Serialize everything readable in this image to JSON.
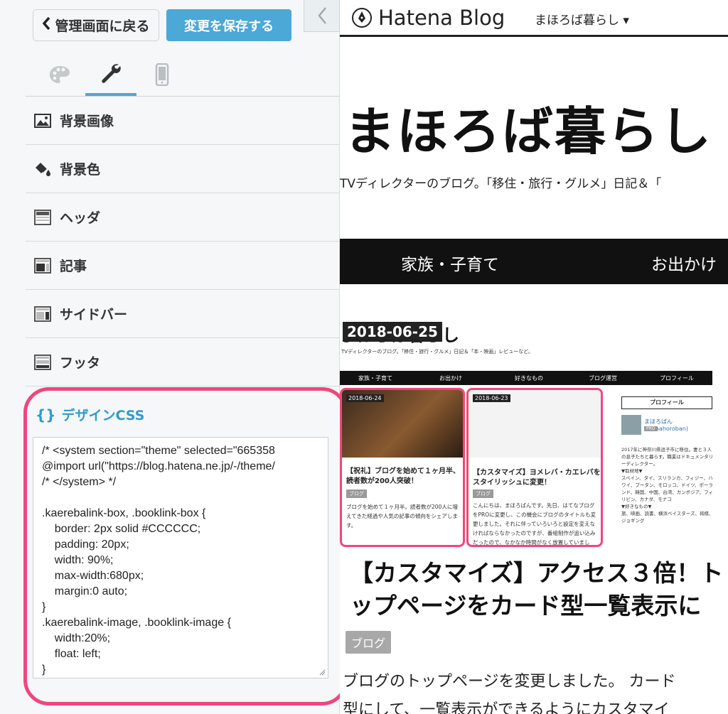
{
  "toolbar": {
    "back_label": "管理画面に戻る",
    "save_label": "変更を保存する"
  },
  "sidebar": {
    "items": [
      {
        "label": "背景画像",
        "icon": "image-icon"
      },
      {
        "label": "背景色",
        "icon": "paint-bucket-icon"
      },
      {
        "label": "ヘッダ",
        "icon": "layout-header-icon"
      },
      {
        "label": "記事",
        "icon": "layout-article-icon"
      },
      {
        "label": "サイドバー",
        "icon": "layout-sidebar-icon"
      },
      {
        "label": "フッタ",
        "icon": "layout-footer-icon"
      }
    ]
  },
  "css_panel": {
    "icon_text": "{}",
    "title": "デザインCSS",
    "code": "/* <system section=\"theme\" selected=\"665358\n@import url(\"https://blog.hatena.ne.jp/-/theme/\n/* </system> */\n\n.kaerebalink-box, .booklink-box {\n    border: 2px solid #CCCCCC;\n    padding: 20px;\n    width: 90%;\n    max-width:680px;\n    margin:0 auto;\n}\n.kaerebalink-image, .booklink-image {\n    width:20%;\n    float: left;\n}"
  },
  "preview": {
    "brand": "Hatena Blog",
    "blog_selector": "まほろば暮らし ▾",
    "blog_title": "まほろば暮らし",
    "blog_desc": "TVディレクターのブログ。「移住・旅行・グルメ」日記＆「",
    "nav": [
      "家族・子育て",
      "お出かけ"
    ],
    "date": "2018-06-25",
    "date_bg": "まほろば暮らし",
    "mini": {
      "desc": "TVディレクターのブログ。「移住・旅行・グルメ」日記＆「本・映画」レビューなど。",
      "nav": [
        "家族・子育て",
        "お出かけ",
        "好きなもの",
        "ブログ運営",
        "プロフィール"
      ],
      "cards": [
        {
          "date": "2018-06-24",
          "title": "【祝礼】ブログを始めて１ヶ月半、読者数が200人突破！",
          "tag": "ブログ",
          "text": "ブログを始めて１ヶ月半。読者数が200人に増えてきた経過や人気の記事の傾向をシェアします。"
        },
        {
          "date": "2018-06-23",
          "title": "【カスタマイズ】ヨメレバ・カエレバをスタイリッシュに変更！",
          "tag": "ブログ",
          "text": "こんにちは、まほろばんです。先日、はてなブログをPROに変更し、この機会にブログのタイトルも変更しました。それに伴っていろいろと設定を変えなければならなかったのですが、番組制作が追い込みだったので、なかなか時間がなく放置していました。ようや…"
        }
      ],
      "profile": {
        "title": "プロフィール",
        "name": "まほろばん (id:mahoroban)",
        "badge": "PRO",
        "text": "2017年に神奈川県逗子市に移住。妻と３人の息子たちと暮らす。職業はドキュメンタリーディレクター。\n▼取材地▼\nスペイン、タイ、スリランカ、フィジー、ハワイ、ブータン、モロッコ、ドイツ、ポーランド、韓国、中国、台湾、カンボジア、フィリピン、カナダ、モナコ\n▼好きなもの▼\n旅、映画、読書、横浜ベイスターズ、将棋、ジョギング"
      }
    },
    "post_title": "【カスタマイズ】アクセス３倍！トップページをカード型一覧表示に",
    "post_title_line1": "【カスタマイズ】アクセス３倍！ト",
    "post_title_line2": "ップページをカード型一覧表示に",
    "post_tag": "ブログ",
    "post_text_line1": "ブログのトップページを変更しました。 カード",
    "post_text_line2": "型にして、一覧表示ができるようにカスタマイ"
  }
}
